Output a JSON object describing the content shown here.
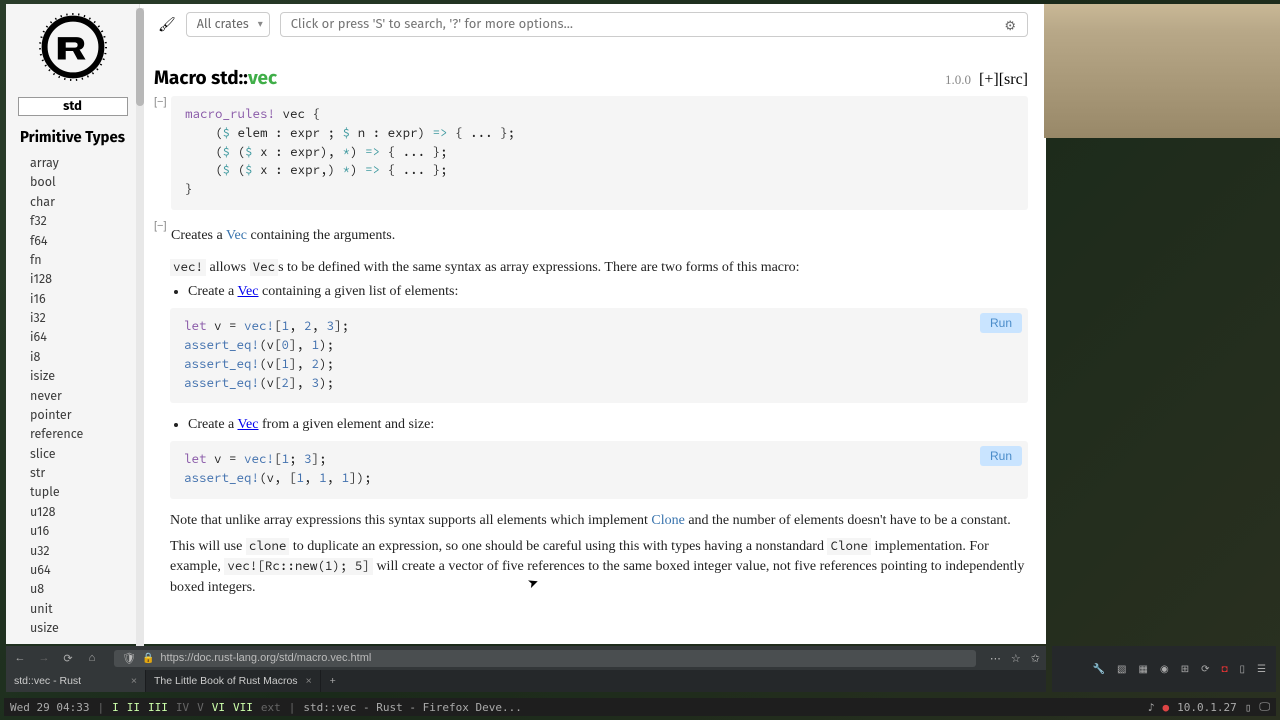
{
  "sidebar": {
    "crate": "std",
    "heading": "Primitive Types",
    "items": [
      "array",
      "bool",
      "char",
      "f32",
      "f64",
      "fn",
      "i128",
      "i16",
      "i32",
      "i64",
      "i8",
      "isize",
      "never",
      "pointer",
      "reference",
      "slice",
      "str",
      "tuple",
      "u128",
      "u16",
      "u32",
      "u64",
      "u8",
      "unit",
      "usize"
    ]
  },
  "topbar": {
    "crates_label": "All crates",
    "search_placeholder": "Click or press 'S' to search, '?' for more options..."
  },
  "title": {
    "kind": "Macro",
    "path": "std::",
    "name": "vec",
    "version": "1.0.0",
    "expand": "[+]",
    "src": "[src]"
  },
  "code": {
    "block1": "macro_rules! vec {\n    ($ elem : expr ; $ n : expr) => { ... };\n    ($ ($ x : expr), *) => { ... };\n    ($ ($ x : expr,) *) => { ... };\n}",
    "block2": "let v = vec![1, 2, 3];\nassert_eq!(v[0], 1);\nassert_eq!(v[1], 2);\nassert_eq!(v[2], 3);",
    "block3": "let v = vec![1; 3];\nassert_eq!(v, [1, 1, 1]);"
  },
  "doc": {
    "p1a": "Creates a ",
    "p1b": " containing the arguments.",
    "p2a": " allows ",
    "p2b": "s to be defined with the same syntax as array expressions. There are two forms of this macro:",
    "li1a": "Create a ",
    "li1b": " containing a given list of elements:",
    "li2a": "Create a ",
    "li2b": " from a given element and size:",
    "p3a": "Note that unlike array expressions this syntax supports all elements which implement ",
    "p3b": " and the number of elements doesn't have to be a constant.",
    "p4a": "This will use ",
    "p4b": " to duplicate an expression, so one should be careful using this with types having a nonstandard ",
    "p4c": " implementation. For example, ",
    "p4d": " will create a vector of five references to the same boxed integer value, not five references pointing to independently boxed integers.",
    "vec_link": "Vec",
    "clone_link": "Clone",
    "vec_bang": "vec!",
    "clone_code": "clone",
    "Clone_code": "Clone",
    "rc_code": "vec![Rc::new(1); 5]"
  },
  "run_label": "Run",
  "collapse": "[−]",
  "browser": {
    "url": "https://doc.rust-lang.org/std/macro.vec.html",
    "tabs": [
      "std::vec - Rust",
      "The Little Book of Rust Macros"
    ]
  },
  "sys": {
    "ip": "10.0.1.27"
  },
  "taskbar": {
    "clock": "Wed 29 04:33",
    "ws": [
      "I",
      "II",
      "III",
      "IV",
      "V",
      "VI",
      "VII"
    ],
    "ext": "ext",
    "title": "std::vec - Rust - Firefox Deve..."
  }
}
